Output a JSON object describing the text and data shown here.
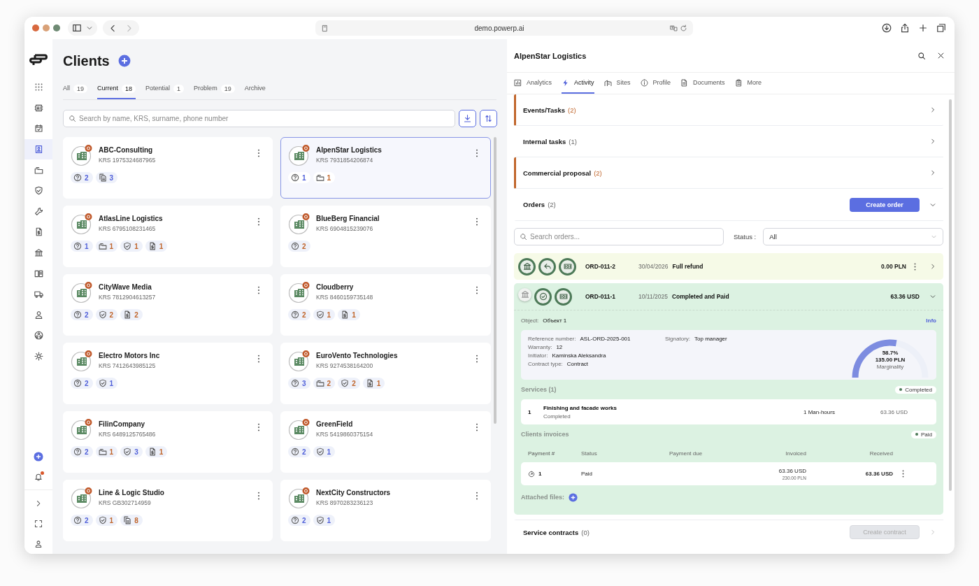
{
  "browser": {
    "url": "demo.powerp.ai"
  },
  "sidebar": {
    "items": [
      {
        "kind": "apps",
        "selected": false
      },
      {
        "kind": "ai",
        "selected": false
      },
      {
        "kind": "calendar",
        "selected": false
      },
      {
        "kind": "clients",
        "selected": true
      },
      {
        "kind": "folders",
        "selected": false
      },
      {
        "kind": "shield",
        "selected": false
      },
      {
        "kind": "wrench",
        "selected": false
      },
      {
        "kind": "invoice",
        "selected": false
      },
      {
        "kind": "bank",
        "selected": false
      },
      {
        "kind": "book",
        "selected": false
      },
      {
        "kind": "truck",
        "selected": false
      },
      {
        "kind": "person",
        "selected": false
      },
      {
        "kind": "network",
        "selected": false
      },
      {
        "kind": "gear",
        "selected": false
      }
    ],
    "bottom": [
      {
        "kind": "add"
      },
      {
        "kind": "bell",
        "alert": true
      },
      {
        "kind": "expand"
      },
      {
        "kind": "fullscreen"
      },
      {
        "kind": "user"
      }
    ]
  },
  "clients": {
    "title": "Clients",
    "tabs": [
      {
        "label": "All",
        "count": "19",
        "selected": false
      },
      {
        "label": "Current",
        "count": "18",
        "selected": true
      },
      {
        "label": "Potential",
        "count": "1",
        "selected": false
      },
      {
        "label": "Problem",
        "count": "19",
        "selected": false
      },
      {
        "label": "Archive",
        "selected": false
      }
    ],
    "search": {
      "placeholder": "Search by name, KRS, surname, phone number"
    },
    "cards": [
      {
        "name": "ABC-Consulting",
        "krs": "KRS 1975324687965",
        "selected": false,
        "chips": [
          {
            "kind": "question",
            "count": "2",
            "color": "#4f5fd9"
          },
          {
            "kind": "docs",
            "count": "3",
            "color": "#4f5fd9"
          }
        ]
      },
      {
        "name": "AlpenStar Logistics",
        "krs": "KRS 7931854206874",
        "selected": true,
        "chips": [
          {
            "kind": "question",
            "count": "1",
            "color": "#4f5fd9"
          },
          {
            "kind": "folders",
            "count": "1",
            "color": "#c0652b"
          }
        ]
      },
      {
        "name": "AtlasLine Logistics",
        "krs": "KRS 6795108231465",
        "selected": false,
        "chips": [
          {
            "kind": "question",
            "count": "1",
            "color": "#4f5fd9"
          },
          {
            "kind": "folders",
            "count": "1",
            "color": "#c0652b"
          },
          {
            "kind": "shield",
            "count": "1",
            "color": "#c0652b"
          },
          {
            "kind": "invoice",
            "count": "1",
            "color": "#c0652b"
          }
        ]
      },
      {
        "name": "BlueBerg Financial",
        "krs": "KRS 6904815239076",
        "selected": false,
        "chips": [
          {
            "kind": "question",
            "count": "2",
            "color": "#c0652b"
          }
        ]
      },
      {
        "name": "CityWave Media",
        "krs": "KRS 7812904613257",
        "selected": false,
        "chips": [
          {
            "kind": "question",
            "count": "2",
            "color": "#4f5fd9"
          },
          {
            "kind": "shield",
            "count": "2",
            "color": "#c0652b"
          },
          {
            "kind": "invoice",
            "count": "2",
            "color": "#c0652b"
          }
        ]
      },
      {
        "name": "Cloudberry",
        "krs": "KRS 8460159735148",
        "selected": false,
        "chips": [
          {
            "kind": "question",
            "count": "2",
            "color": "#c0652b"
          },
          {
            "kind": "shield",
            "count": "1",
            "color": "#c0652b"
          },
          {
            "kind": "invoice",
            "count": "1",
            "color": "#c0652b"
          }
        ]
      },
      {
        "name": "Electro Motors Inc",
        "krs": "KRS 7412643985125",
        "selected": false,
        "chips": [
          {
            "kind": "question",
            "count": "2",
            "color": "#4f5fd9"
          },
          {
            "kind": "shield",
            "count": "1",
            "color": "#4f5fd9"
          }
        ]
      },
      {
        "name": "EuroVento Technologies",
        "krs": "KRS 9274538164200",
        "selected": false,
        "chips": [
          {
            "kind": "question",
            "count": "3",
            "color": "#4f5fd9"
          },
          {
            "kind": "folders",
            "count": "2",
            "color": "#c0652b"
          },
          {
            "kind": "shield",
            "count": "2",
            "color": "#c0652b"
          },
          {
            "kind": "invoice",
            "count": "1",
            "color": "#c0652b"
          }
        ]
      },
      {
        "name": "FilinCompany",
        "krs": "KRS 6489125765486",
        "selected": false,
        "chips": [
          {
            "kind": "question",
            "count": "2",
            "color": "#4f5fd9"
          },
          {
            "kind": "folders",
            "count": "1",
            "color": "#c0652b"
          },
          {
            "kind": "shield",
            "count": "3",
            "color": "#4f5fd9"
          },
          {
            "kind": "invoice",
            "count": "1",
            "color": "#c0652b"
          }
        ]
      },
      {
        "name": "GreenField",
        "krs": "KRS 5419860375154",
        "selected": false,
        "chips": [
          {
            "kind": "question",
            "count": "2",
            "color": "#4f5fd9"
          },
          {
            "kind": "shield",
            "count": "1",
            "color": "#4f5fd9"
          }
        ]
      },
      {
        "name": "Line & Logic Studio",
        "krs": "KRS GB302714959",
        "selected": false,
        "chips": [
          {
            "kind": "question",
            "count": "2",
            "color": "#4f5fd9"
          },
          {
            "kind": "shield",
            "count": "1",
            "color": "#c0652b"
          },
          {
            "kind": "docs",
            "count": "8",
            "color": "#c0652b"
          }
        ]
      },
      {
        "name": "NextCity Constructors",
        "krs": "KRS 8970283236123",
        "selected": false,
        "chips": [
          {
            "kind": "question",
            "count": "2",
            "color": "#4f5fd9"
          },
          {
            "kind": "shield",
            "count": "1",
            "color": "#4f5fd9"
          }
        ]
      }
    ]
  },
  "detail": {
    "title": "AlpenStar Logistics",
    "tabs": [
      {
        "label": "Analytics",
        "kind": "analytics",
        "selected": false
      },
      {
        "label": "Activity",
        "kind": "bolt",
        "selected": true
      },
      {
        "label": "Sites",
        "kind": "sites",
        "selected": false
      },
      {
        "label": "Profile",
        "kind": "info",
        "selected": false
      },
      {
        "label": "Documents",
        "kind": "document",
        "selected": false
      },
      {
        "label": "More",
        "kind": "clipboard",
        "selected": false
      }
    ],
    "sections": [
      {
        "title": "Events/Tasks",
        "count": "(2)",
        "flagged": true
      },
      {
        "title": "Internal tasks",
        "count": "(1)",
        "flagged": false
      },
      {
        "title": "Commercial proposal",
        "count": "(2)",
        "flagged": true
      }
    ],
    "orders": {
      "title": "Orders",
      "count": "(2)",
      "expanded": true,
      "button": "Create order",
      "search": {
        "placeholder": "Search orders..."
      },
      "status_label": "Status :",
      "status_value": "All",
      "rows": [
        {
          "kind": "refund",
          "number": "ORD-011-2",
          "date": "30/04/2026",
          "status": "Full refund",
          "amount": "0.00 PLN",
          "expanded": false,
          "icons": [
            {
              "kind": "bank",
              "active": true
            },
            {
              "kind": "reply",
              "active": true
            },
            {
              "kind": "cash",
              "active": true
            }
          ]
        },
        {
          "kind": "completed",
          "number": "ORD-011-1",
          "date": "10/11/2025",
          "status": "Completed and Paid",
          "amount": "63.36 USD",
          "expanded": true,
          "icons": [
            {
              "kind": "bank",
              "active": false
            },
            {
              "kind": "check",
              "active": true
            },
            {
              "kind": "cash",
              "active": true
            }
          ],
          "object_label": "Object:",
          "object_value": "Объект 1",
          "info_link": "Info",
          "fields": [
            {
              "label": "Reference number:",
              "value": "ASL-ORD-2025-001"
            },
            {
              "label": "Warranty:",
              "value": "12"
            },
            {
              "label": "Initiator:",
              "value": "Kaminska Aleksandra"
            },
            {
              "label": "Contract type:",
              "value": "Contract"
            },
            {
              "label": "Signatory:",
              "value": "Top manager"
            }
          ],
          "gauge": {
            "level": 0.587,
            "percent": "58.7%",
            "amount": "135.00 PLN",
            "label": "Marginality"
          },
          "services": {
            "title": "Services (1)",
            "badge": "Completed",
            "rows": [
              {
                "index": "1",
                "name": "Finishing and facade works",
                "status": "Completed",
                "quantity": "1 Man-hours",
                "price": "63.36 USD"
              }
            ]
          },
          "invoices": {
            "title": "Clients invoices",
            "badge": "Paid",
            "columns": [
              "Payment #",
              "Status",
              "Payment due",
              "Invoiced",
              "Received"
            ],
            "rows": [
              {
                "number": "1",
                "status": "Paid",
                "invoiced": "63.36 USD",
                "invoiced_sub": "230.00 PLN",
                "received": "63.36 USD"
              }
            ]
          },
          "attached_label": "Attached files:"
        }
      ]
    },
    "service_contracts": {
      "title": "Service contracts",
      "count": "(0)",
      "button": "Create contract",
      "disabled": true
    }
  }
}
